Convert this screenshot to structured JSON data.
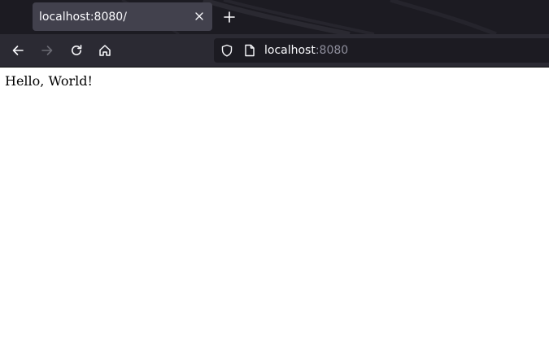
{
  "tab": {
    "title": "localhost:8080/",
    "close_icon": "close-icon",
    "new_tab_icon": "plus-icon"
  },
  "navigation": {
    "back_icon": "arrow-left-icon",
    "forward_icon": "arrow-right-icon",
    "forward_enabled": false,
    "reload_icon": "reload-icon",
    "home_icon": "home-icon"
  },
  "urlbar": {
    "host": "localhost",
    "port": ":8080",
    "security_icon": "shield-icon",
    "page_icon": "page-icon"
  },
  "page": {
    "body_text": "Hello, World!"
  },
  "colors": {
    "tabstrip_bg": "#1c1b22",
    "selected_tab_bg": "#42414d",
    "toolbar_bg": "#2b2a33",
    "urlbar_bg": "#1c1b22",
    "text_light": "#fbfbfe",
    "text_muted": "#8f8f9d",
    "page_bg": "#ffffff"
  }
}
